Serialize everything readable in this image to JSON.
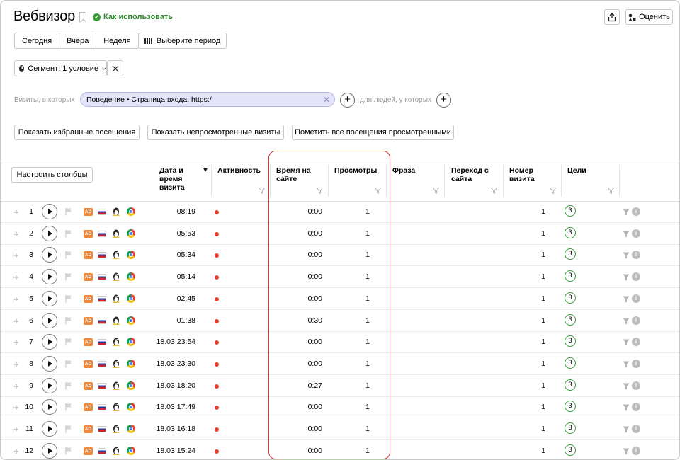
{
  "header": {
    "title": "Вебвизор",
    "howto_label": "Как использовать",
    "rate_label": "Оценить"
  },
  "periods": {
    "today": "Сегодня",
    "yesterday": "Вчера",
    "week": "Неделя",
    "choose_period": "Выберите период"
  },
  "segment": {
    "label": "Сегмент: 1 условие"
  },
  "filters": {
    "visits_label": "Визиты, в которых",
    "chip_text": "Поведение • Страница входа: https:/",
    "people_label": "для людей, у которых"
  },
  "actions": {
    "show_favorites": "Показать избранные посещения",
    "show_unviewed": "Показать непросмотренные визиты",
    "mark_all_viewed": "Пометить все посещения просмотренными"
  },
  "table": {
    "configure_columns": "Настроить столбцы",
    "columns": {
      "date": [
        "Дата и",
        "время",
        "визита"
      ],
      "activity": [
        "Активность"
      ],
      "time_on_site": [
        "Время на",
        "сайте"
      ],
      "views": [
        "Просмотры"
      ],
      "phrase": [
        "Фраза"
      ],
      "transition": [
        "Переход с",
        "сайта"
      ],
      "visit_number": [
        "Номер",
        "визита"
      ],
      "goals": [
        "Цели"
      ]
    },
    "ad_badge": "AD",
    "rows": [
      {
        "num": "1",
        "date": "08:19",
        "time": "0:00",
        "views": "1",
        "visit_num": "1",
        "goals": "3"
      },
      {
        "num": "2",
        "date": "05:53",
        "time": "0:00",
        "views": "1",
        "visit_num": "1",
        "goals": "3"
      },
      {
        "num": "3",
        "date": "05:34",
        "time": "0:00",
        "views": "1",
        "visit_num": "1",
        "goals": "3"
      },
      {
        "num": "4",
        "date": "05:14",
        "time": "0:00",
        "views": "1",
        "visit_num": "1",
        "goals": "3"
      },
      {
        "num": "5",
        "date": "02:45",
        "time": "0:00",
        "views": "1",
        "visit_num": "1",
        "goals": "3"
      },
      {
        "num": "6",
        "date": "01:38",
        "time": "0:30",
        "views": "1",
        "visit_num": "1",
        "goals": "3"
      },
      {
        "num": "7",
        "date": "18.03 23:54",
        "time": "0:00",
        "views": "1",
        "visit_num": "1",
        "goals": "3"
      },
      {
        "num": "8",
        "date": "18.03 23:30",
        "time": "0:00",
        "views": "1",
        "visit_num": "1",
        "goals": "3"
      },
      {
        "num": "9",
        "date": "18.03 18:20",
        "time": "0:27",
        "views": "1",
        "visit_num": "1",
        "goals": "3"
      },
      {
        "num": "10",
        "date": "18.03 17:49",
        "time": "0:00",
        "views": "1",
        "visit_num": "1",
        "goals": "3"
      },
      {
        "num": "11",
        "date": "18.03 16:18",
        "time": "0:00",
        "views": "1",
        "visit_num": "1",
        "goals": "3"
      },
      {
        "num": "12",
        "date": "18.03 15:24",
        "time": "0:00",
        "views": "1",
        "visit_num": "1",
        "goals": "3"
      }
    ]
  },
  "colors": {
    "accent_green": "#3a9c3a",
    "activity_dot": "#e8402c",
    "highlight": "#e0312e",
    "chip_bg": "#e3e3fa",
    "ad_orange": "#f0883a"
  }
}
